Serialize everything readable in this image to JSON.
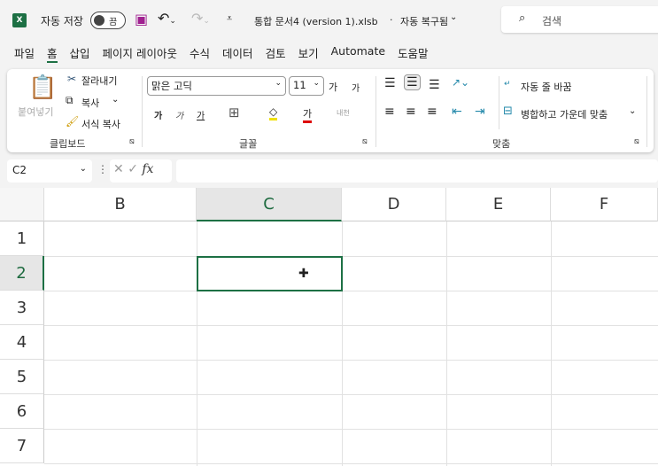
{
  "titlebar": {
    "autosave_label": "자동 저장",
    "toggle_state": "끔",
    "filename": "통합 문서4 (version 1).xlsb",
    "status": "자동 복구됨",
    "search_placeholder": "검색"
  },
  "tabs": [
    "파일",
    "홈",
    "삽입",
    "페이지 레이아웃",
    "수식",
    "데이터",
    "검토",
    "보기",
    "Automate",
    "도움말"
  ],
  "active_tab": "홈",
  "ribbon": {
    "clipboard": {
      "paste": "붙여넣기",
      "cut": "잘라내기",
      "copy": "복사",
      "format_painter": "서식 복사",
      "group": "클립보드"
    },
    "font": {
      "name": "맑은 고딕",
      "size": "11",
      "grow": "가",
      "shrink": "가",
      "bold": "가",
      "italic": "가",
      "underline": "가",
      "font_color": "가",
      "group": "글꼴"
    },
    "alignment": {
      "wrap": "자동 줄 바꿈",
      "merge": "병합하고 가운데 맞춤",
      "group": "맞춤"
    }
  },
  "formula_bar": {
    "name_box": "C2",
    "fx": "fx",
    "value": ""
  },
  "grid": {
    "columns": [
      "B",
      "C",
      "D",
      "E",
      "F"
    ],
    "rows": [
      "1",
      "2",
      "3",
      "4",
      "5",
      "6",
      "7"
    ],
    "selected_cell": "C2"
  }
}
